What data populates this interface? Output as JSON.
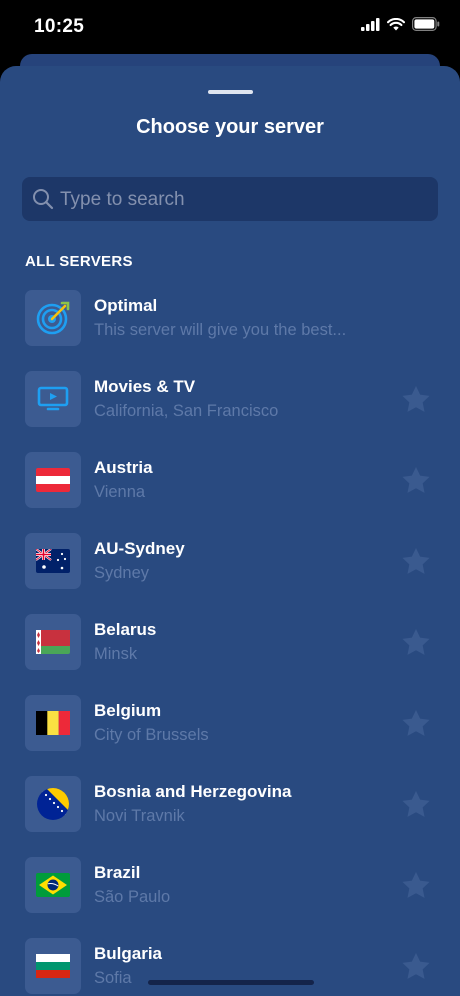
{
  "status": {
    "time": "10:25"
  },
  "sheet": {
    "title": "Choose your server",
    "search_placeholder": "Type to search",
    "section_label": "ALL SERVERS"
  },
  "servers": [
    {
      "name": "Optimal",
      "subtitle": "This server will give you the best...",
      "icon": "target-icon",
      "favorite": false
    },
    {
      "name": "Movies & TV",
      "subtitle": "California, San Francisco",
      "icon": "tv-icon",
      "favorite": true
    },
    {
      "name": "Austria",
      "subtitle": "Vienna",
      "icon": "austria-flag-icon",
      "favorite": true
    },
    {
      "name": "AU-Sydney",
      "subtitle": "Sydney",
      "icon": "australia-flag-icon",
      "favorite": true
    },
    {
      "name": "Belarus",
      "subtitle": "Minsk",
      "icon": "belarus-flag-icon",
      "favorite": true
    },
    {
      "name": "Belgium",
      "subtitle": "City of Brussels",
      "icon": "belgium-flag-icon",
      "favorite": true
    },
    {
      "name": "Bosnia and Herzegovina",
      "subtitle": "Novi Travnik",
      "icon": "bosnia-flag-icon",
      "favorite": true
    },
    {
      "name": "Brazil",
      "subtitle": "São Paulo",
      "icon": "brazil-flag-icon",
      "favorite": true
    },
    {
      "name": "Bulgaria",
      "subtitle": "Sofia",
      "icon": "bulgaria-flag-icon",
      "favorite": true
    }
  ],
  "colors": {
    "sheet": "#294a80",
    "search": "#1d3768",
    "tile": "#3c5b91",
    "subtitle": "#5e79a8",
    "star": "#3a5a8f"
  }
}
